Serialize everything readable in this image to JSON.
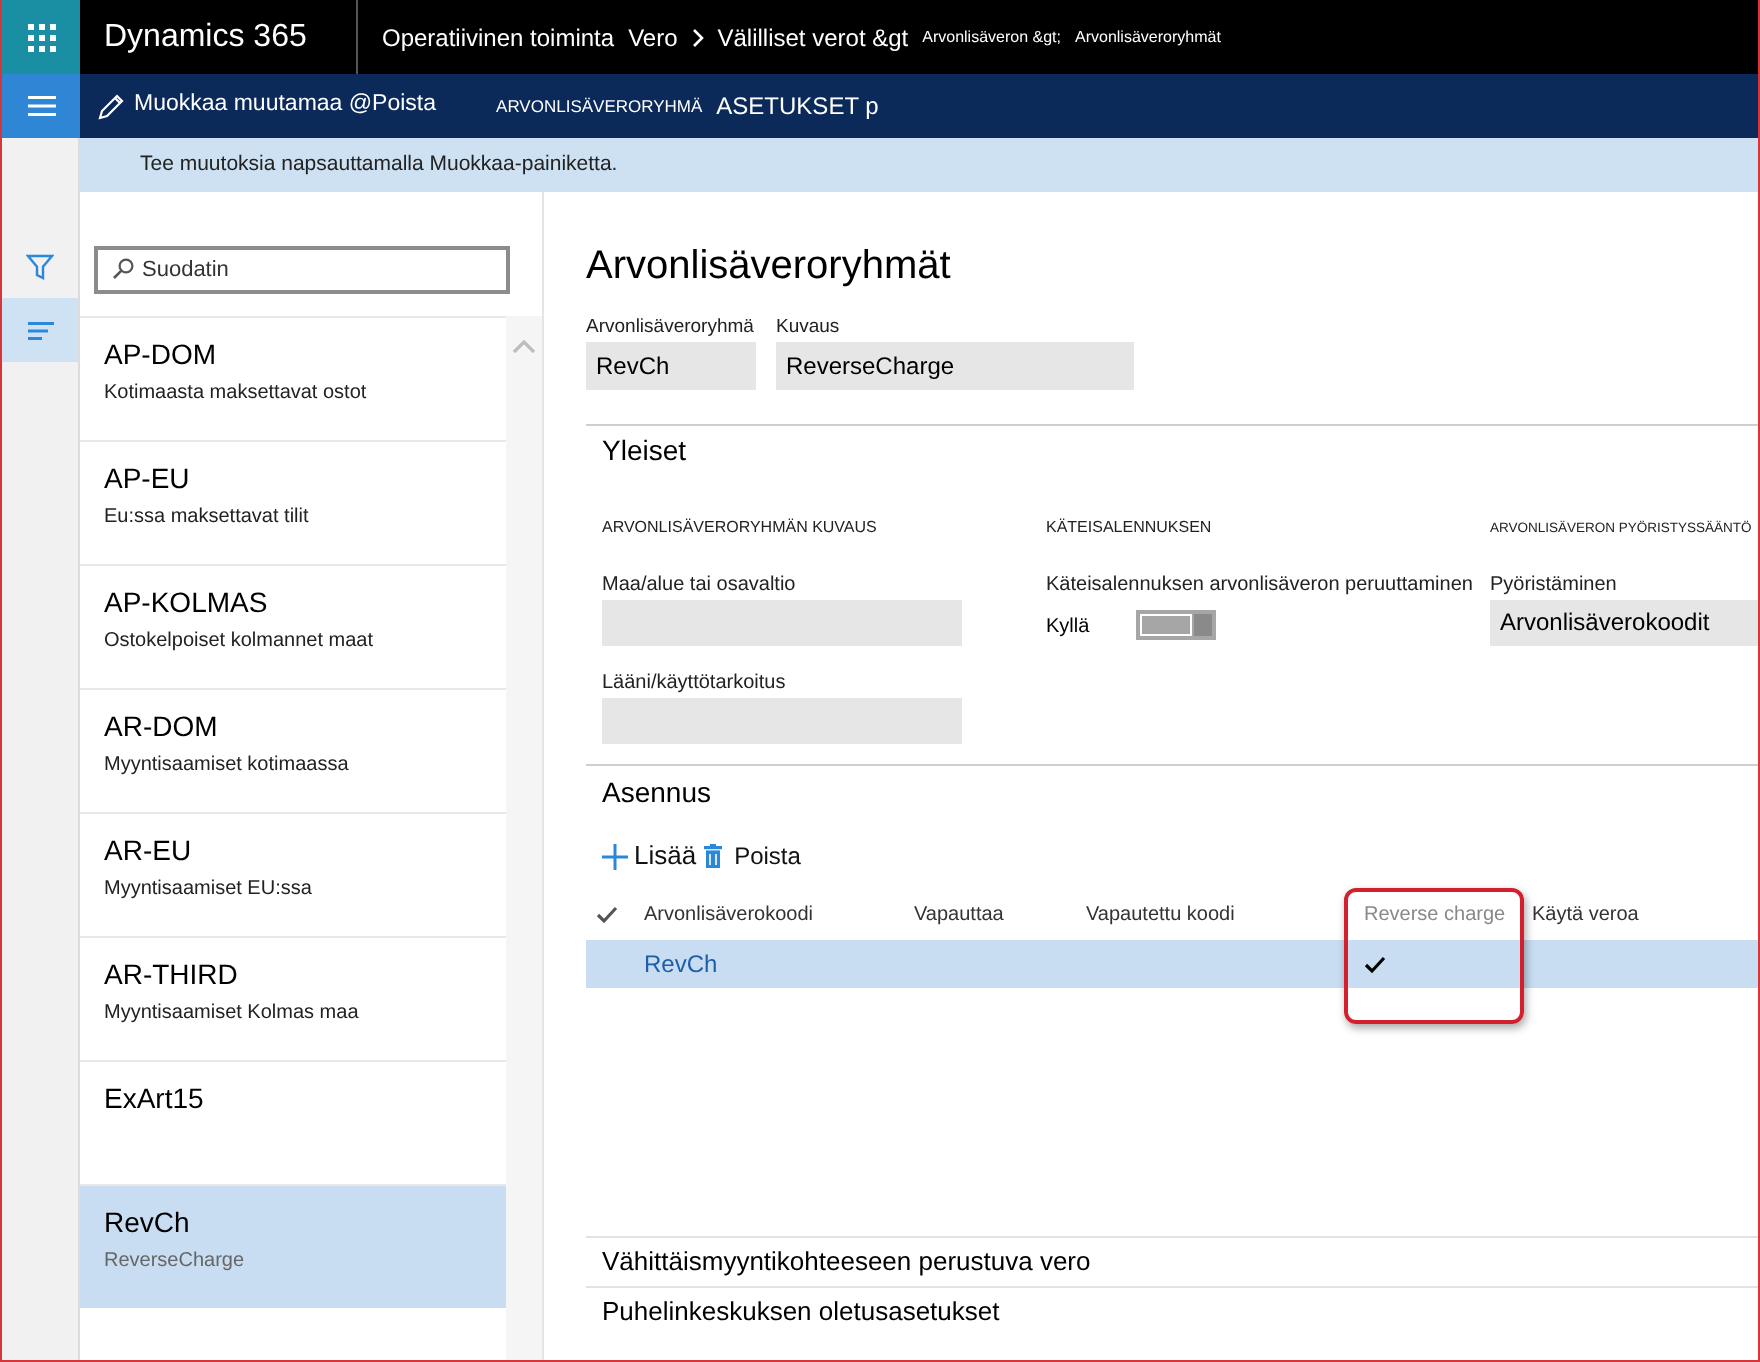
{
  "app_bar": {
    "app_name": "Dynamics 365",
    "breadcrumb": [
      {
        "label": "Operatiivinen toiminta",
        "kind": "large",
        "chevron": false
      },
      {
        "label": "Vero",
        "kind": "large",
        "chevron": true
      },
      {
        "label": "Välilliset verot &gt",
        "kind": "large",
        "chevron": false
      },
      {
        "label": "Arvonlisäveron &gt;",
        "kind": "small",
        "chevron": false
      },
      {
        "label": "Arvonlisäveroryhmät",
        "kind": "small",
        "chevron": false
      }
    ]
  },
  "action_bar": {
    "edit": "Muokkaa muutamaa @Poista",
    "items": [
      {
        "label": "ARVONLISÄVERORYHMÄ",
        "kind": "small"
      },
      {
        "label": "ASETUKSET p",
        "kind": "large"
      }
    ]
  },
  "message": "Tee muutoksia napsauttamalla Muokkaa-painiketta.",
  "rail": [
    {
      "kind": "filter",
      "selected": false
    },
    {
      "kind": "list",
      "selected": true
    }
  ],
  "list": {
    "search": {
      "placeholder": "Suodatin"
    },
    "items": [
      {
        "title": "AP-DOM",
        "subtitle": "Kotimaasta maksettavat ostot",
        "selected": false
      },
      {
        "title": "AP-EU",
        "subtitle": "Eu:ssa maksettavat tilit",
        "selected": false
      },
      {
        "title": "AP-KOLMAS",
        "subtitle": "Ostokelpoiset kolmannet maat",
        "selected": false
      },
      {
        "title": "AR-DOM",
        "subtitle": "Myyntisaamiset kotimaassa",
        "selected": false
      },
      {
        "title": "AR-EU",
        "subtitle": "Myyntisaamiset EU:ssa",
        "selected": false
      },
      {
        "title": "AR-THIRD",
        "subtitle": "Myyntisaamiset Kolmas maa",
        "selected": false
      },
      {
        "title": "ExArt15",
        "selected": false
      },
      {
        "title": "RevCh",
        "subtitle": "ReverseCharge",
        "selected": true
      }
    ]
  },
  "form": {
    "title": "Arvonlisäveroryhmät",
    "header_fields": [
      {
        "label": "Arvonlisäveroryhmä",
        "value": "RevCh"
      },
      {
        "label": "Kuvaus",
        "value": "ReverseCharge"
      }
    ],
    "general": {
      "title": "Yleiset",
      "groups": [
        {
          "heading": "ARVONLISÄVERORYHMÄN KUVAUS",
          "fields": [
            {
              "kind": "text",
              "label": "Maa/alue tai osavaltio"
            },
            {
              "kind": "text",
              "label": "Lääni/käyttötarkoitus"
            }
          ]
        },
        {
          "heading": "KÄTEISALENNUKSEN",
          "fields": [
            {
              "kind": "toggle",
              "label": "Käteisalennuksen arvonlisäveron peruuttaminen",
              "state_label": "Kyllä",
              "on": true
            }
          ]
        },
        {
          "heading": "ARVONLISÄVERON PYÖRISTYSSÄÄNTÖ",
          "fields": [
            {
              "kind": "select",
              "label": "Pyöristäminen",
              "value": "Arvonlisäverokoodit"
            }
          ]
        }
      ]
    },
    "setup": {
      "title": "Asennus",
      "actions": [
        {
          "kind": "add",
          "label": "Lisää"
        },
        {
          "kind": "delete",
          "label": "Poista"
        }
      ],
      "columns": [
        {
          "label": "Arvonlisäverokoodi",
          "highlighted": false
        },
        {
          "label": "Vapauttaa",
          "highlighted": false
        },
        {
          "label": "Vapautettu koodi",
          "highlighted": false
        },
        {
          "label": "Reverse charge",
          "highlighted": true
        },
        {
          "label": "Käytä veroa",
          "highlighted": false
        }
      ],
      "rows": [
        {
          "selected": true,
          "code": "RevCh",
          "exempt": false,
          "reverse_charge": true,
          "use_tax": false
        }
      ]
    },
    "collapsed_sections": [
      "Vähittäismyyntikohteeseen perustuva vero",
      "Puhelinkeskuksen oletusasetukset"
    ]
  }
}
